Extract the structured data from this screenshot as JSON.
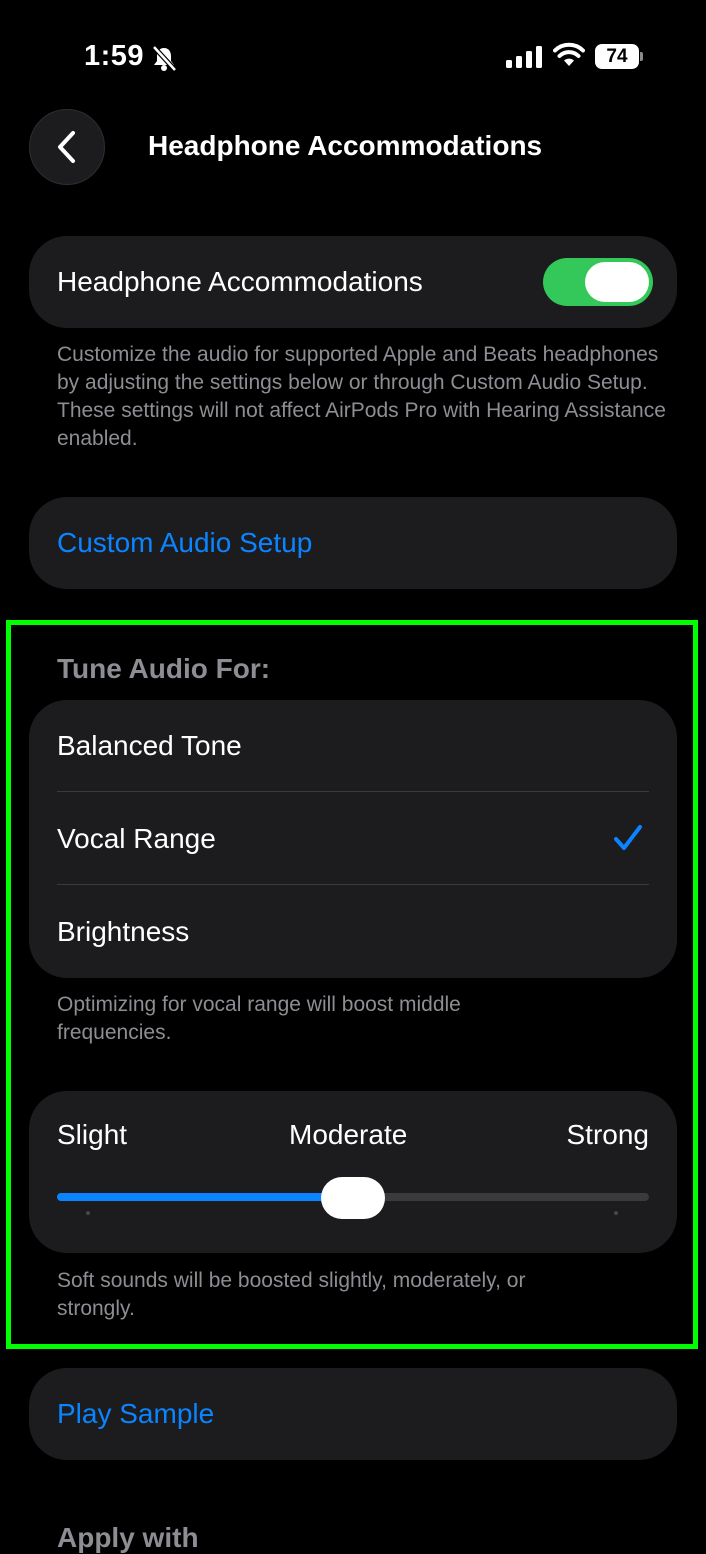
{
  "status_bar": {
    "time": "1:59",
    "battery": "74"
  },
  "nav": {
    "title": "Headphone Accommodations"
  },
  "toggle_row": {
    "label": "Headphone Accommodations",
    "value": true
  },
  "toggle_footer": "Customize the audio for supported Apple and Beats headphones by adjusting the settings below or through Custom Audio Setup. These settings will not affect AirPods Pro with Hearing Assistance enabled.",
  "custom_audio": {
    "label": "Custom Audio Setup"
  },
  "tune": {
    "header": "Tune Audio For:",
    "options": [
      {
        "label": "Balanced Tone",
        "selected": false
      },
      {
        "label": "Vocal Range",
        "selected": true
      },
      {
        "label": "Brightness",
        "selected": false
      }
    ],
    "footer": "Optimizing for vocal range will boost middle frequencies."
  },
  "boost": {
    "labels": [
      "Slight",
      "Moderate",
      "Strong"
    ],
    "value_fraction": 0.5,
    "footer": "Soft sounds will be boosted slightly, moderately, or strongly."
  },
  "play_sample": {
    "label": "Play Sample"
  },
  "next_header": "Apply with",
  "colors": {
    "accent": "#0a84ff",
    "toggle_on": "#34c759",
    "highlight": "#00ff00"
  }
}
